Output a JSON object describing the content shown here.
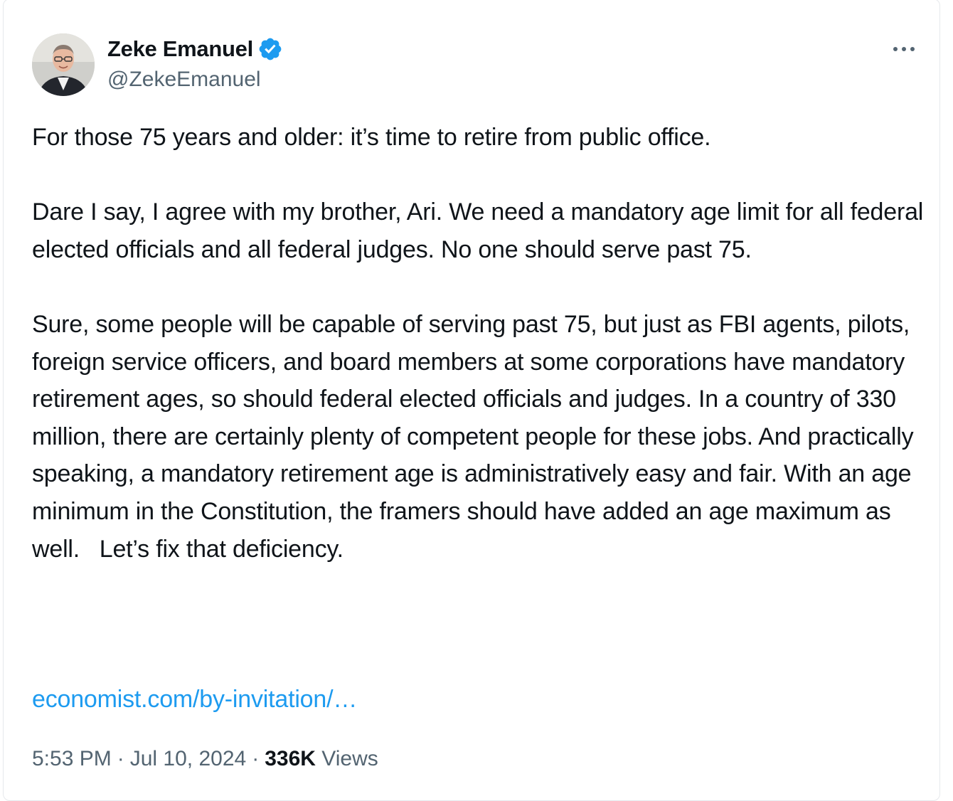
{
  "author": {
    "name": "Zeke Emanuel",
    "handle": "@ZekeEmanuel",
    "verified": true,
    "verified_color": "#1d9bf0"
  },
  "tweet": {
    "paragraph_1": "For those 75 years and older: it’s time to retire from public office.",
    "paragraph_2": "Dare I say, I agree with my brother, Ari. We need a mandatory age limit for all federal elected officials and all federal judges. No one should serve past 75.",
    "paragraph_3": "Sure, some people will be capable of serving past 75, but just as FBI agents, pilots, foreign service officers, and board members at some corporations have mandatory retirement ages, so should federal elected officials and judges. In a country of 330 million, there are certainly plenty of competent people for these jobs. And practically speaking, a mandatory retirement age is administratively easy and fair. With an age minimum in the Constitution, the framers should have added an age maximum as well.   Let’s fix that deficiency.",
    "link_text": "economist.com/by-invitation/…"
  },
  "meta": {
    "time": "5:53 PM",
    "date": "Jul 10, 2024",
    "separator": "·",
    "views_count": "336K",
    "views_label": "Views"
  },
  "icons": {
    "verified": "verified-badge-icon",
    "more": "more-options-icon"
  },
  "colors": {
    "text": "#0f1419",
    "secondary": "#536471",
    "link": "#1d9bf0"
  }
}
